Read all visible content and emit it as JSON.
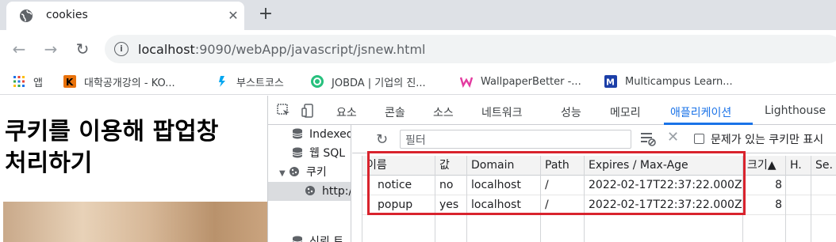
{
  "browser": {
    "tab_title": "cookies",
    "tab_close": "✕",
    "new_tab": "+",
    "back": "←",
    "forward": "→",
    "reload": "↻",
    "url_host": "localhost",
    "url_rest": ":9090/webApp/javascript/jsnew.html",
    "bookmarks": [
      {
        "label": "앱",
        "icon": "apps-grid-icon",
        "color": "#1a73e8"
      },
      {
        "label": "대학공개강의 - KO...",
        "icon": "kocw-icon",
        "color": "#e8710a"
      },
      {
        "label": "부스트코스",
        "icon": "boostcourse-icon",
        "color": "#00a6f0"
      },
      {
        "label": "JOBDA | 기업의 진...",
        "icon": "jobda-icon",
        "color": "#27c07d"
      },
      {
        "label": "WallpaperBetter -...",
        "icon": "wallpaperbetter-icon",
        "color": "#e33ba0"
      },
      {
        "label": "Multicampus Learn...",
        "icon": "multicampus-icon",
        "color": "#1c3fa8"
      }
    ]
  },
  "page": {
    "heading_line1": "쿠키를 이용해 팝업창",
    "heading_line2": "처리하기"
  },
  "devtools": {
    "tabs": [
      "요소",
      "콘솔",
      "소스",
      "네트워크",
      "성능",
      "메모리",
      "애플리케이션",
      "Lighthouse"
    ],
    "active_tab": "애플리케이션",
    "accent": "#1a73e8",
    "sidebar": [
      {
        "label": "Indexed",
        "icon": "database-icon"
      },
      {
        "label": "웹 SQL",
        "icon": "database-icon"
      },
      {
        "label": "쿠키",
        "icon": "cookie-icon",
        "expanded": true
      },
      {
        "label": "http:/",
        "icon": "cookie-icon",
        "selected": true
      },
      {
        "label": "신뢰 토",
        "icon": "database-icon"
      }
    ],
    "filter_placeholder": "필터",
    "problem_cookies_label": "문제가 있는 쿠키만 표시",
    "table": {
      "headers": [
        "이름",
        "값",
        "Domain",
        "Path",
        "Expires / Max-Age",
        "크기▲",
        "H.",
        "Se."
      ],
      "rows": [
        [
          "notice",
          "no",
          "localhost",
          "/",
          "2022-02-17T22:37:22.000Z",
          "8",
          "",
          ""
        ],
        [
          "popup",
          "yes",
          "localhost",
          "/",
          "2022-02-17T22:37:22.000Z",
          "8",
          "",
          ""
        ]
      ]
    },
    "highlight_color": "#d9232d"
  }
}
